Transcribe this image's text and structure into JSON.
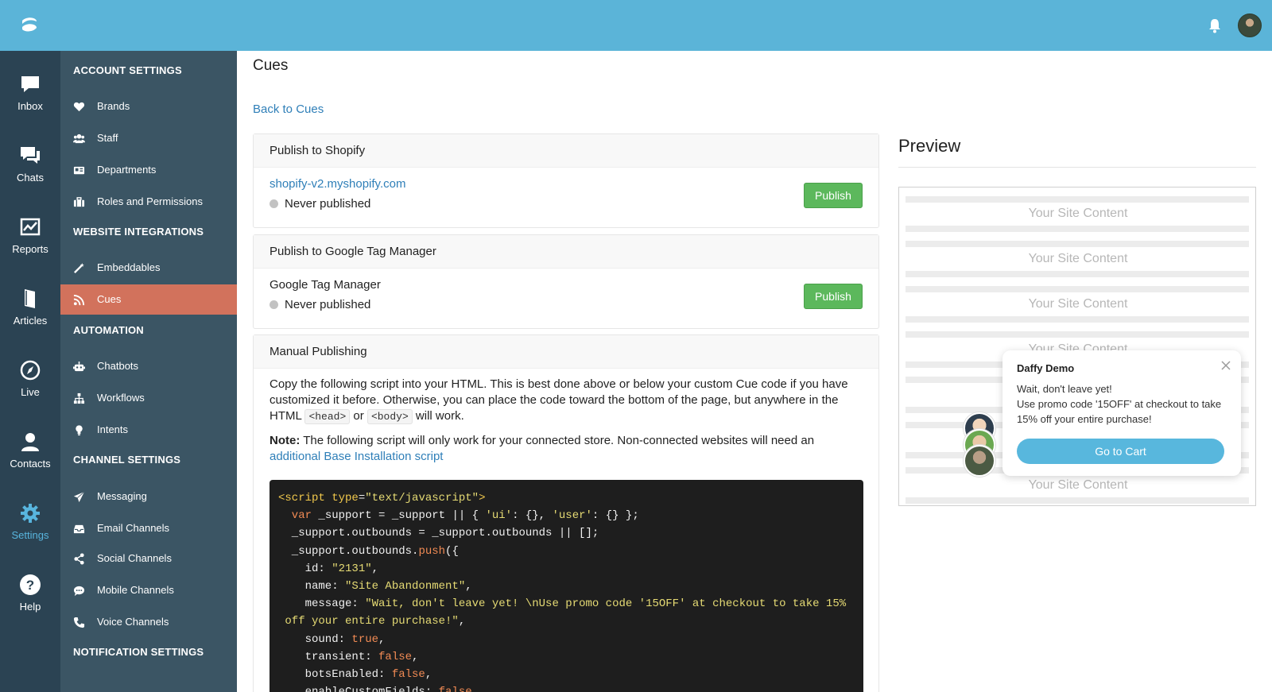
{
  "nav_rail": [
    {
      "label": "Inbox",
      "icon": "inbox-icon"
    },
    {
      "label": "Chats",
      "icon": "chats-icon"
    },
    {
      "label": "Reports",
      "icon": "reports-icon"
    },
    {
      "label": "Articles",
      "icon": "articles-icon"
    },
    {
      "label": "Live",
      "icon": "compass-icon"
    },
    {
      "label": "Contacts",
      "icon": "contacts-icon"
    },
    {
      "label": "Settings",
      "icon": "gear-icon",
      "active": true
    },
    {
      "label": "Help",
      "icon": "help-icon"
    }
  ],
  "settings_menu": {
    "sections": [
      {
        "heading": "ACCOUNT SETTINGS",
        "items": [
          "Brands",
          "Staff",
          "Departments",
          "Roles and Permissions"
        ]
      },
      {
        "heading": "WEBSITE INTEGRATIONS",
        "items": [
          "Embeddables",
          "Cues"
        ]
      },
      {
        "heading": "AUTOMATION",
        "items": [
          "Chatbots",
          "Workflows",
          "Intents"
        ]
      },
      {
        "heading": "CHANNEL SETTINGS",
        "items": [
          "Messaging",
          "Email Channels",
          "Social Channels",
          "Mobile Channels",
          "Voice Channels"
        ]
      },
      {
        "heading": "NOTIFICATION SETTINGS",
        "items": []
      }
    ],
    "active_item": "Cues"
  },
  "page": {
    "title": "Cues",
    "back_link": "Back to Cues"
  },
  "shopify": {
    "heading": "Publish to Shopify",
    "store": "shopify-v2.myshopify.com",
    "status": "Never published",
    "button": "Publish"
  },
  "gtm": {
    "heading": "Publish to Google Tag Manager",
    "name": "Google Tag Manager",
    "status": "Never published",
    "button": "Publish"
  },
  "manual": {
    "heading": "Manual Publishing",
    "instructions_pre": "Copy the following script into your HTML. This is best done above or below your custom Cue code if you have customized it before. Otherwise, you can place the code toward the bottom of the page, but anywhere in the HTML ",
    "code_head": "<head>",
    "instructions_or": " or ",
    "code_body": "<body>",
    "instructions_post": " will work.",
    "note_label": "Note:",
    "note_text": " The following script will only work for your connected store. Non-connected websites will need an ",
    "note_link": "additional Base Installation script"
  },
  "code": {
    "lines": [
      [
        [
          "tag",
          "<script "
        ],
        [
          "attr",
          "type"
        ],
        [
          "plain",
          "="
        ],
        [
          "str",
          "\"text/javascript\""
        ],
        [
          "tag",
          ">"
        ]
      ],
      [
        [
          "kw",
          "  var"
        ],
        [
          "plain",
          " _support = _support || { "
        ],
        [
          "str",
          "'ui'"
        ],
        [
          "plain",
          ": {}, "
        ],
        [
          "str",
          "'user'"
        ],
        [
          "plain",
          ": {} };"
        ]
      ],
      [
        [
          "plain",
          "  _support.outbounds = _support.outbounds || [];"
        ]
      ],
      [
        [
          "plain",
          "  _support.outbounds."
        ],
        [
          "kw",
          "push"
        ],
        [
          "plain",
          "({"
        ]
      ],
      [
        [
          "plain",
          "    id: "
        ],
        [
          "str",
          "\"2131\""
        ],
        [
          "plain",
          ","
        ]
      ],
      [
        [
          "plain",
          "    name: "
        ],
        [
          "str",
          "\"Site Abandonment\""
        ],
        [
          "plain",
          ","
        ]
      ],
      [
        [
          "plain",
          "    message: "
        ],
        [
          "str",
          "\"Wait, don't leave yet! \\nUse promo code '15OFF' at checkout to take 15%"
        ]
      ],
      [
        [
          "str",
          " off your entire purchase!\""
        ],
        [
          "plain",
          ","
        ]
      ],
      [
        [
          "plain",
          "    sound: "
        ],
        [
          "kw",
          "true"
        ],
        [
          "plain",
          ","
        ]
      ],
      [
        [
          "plain",
          "    transient: "
        ],
        [
          "kw",
          "false"
        ],
        [
          "plain",
          ","
        ]
      ],
      [
        [
          "plain",
          "    botsEnabled: "
        ],
        [
          "kw",
          "false"
        ],
        [
          "plain",
          ","
        ]
      ],
      [
        [
          "plain",
          "    enableCustomFields: "
        ],
        [
          "kw",
          "false"
        ],
        [
          "plain",
          ","
        ]
      ]
    ]
  },
  "preview": {
    "title": "Preview",
    "site_content_label": "Your Site Content",
    "popup": {
      "brand": "Daffy Demo",
      "message": "Wait, don't leave yet!\nUse promo code '15OFF' at checkout to take 15% off your entire purchase!",
      "button": "Go to Cart"
    }
  },
  "colors": {
    "topbar": "#5bb4d8",
    "rail": "#2b4353",
    "menu": "#3b5564",
    "active_menu": "#d2725c",
    "publish": "#5cb85c",
    "link": "#2f7fb8"
  }
}
